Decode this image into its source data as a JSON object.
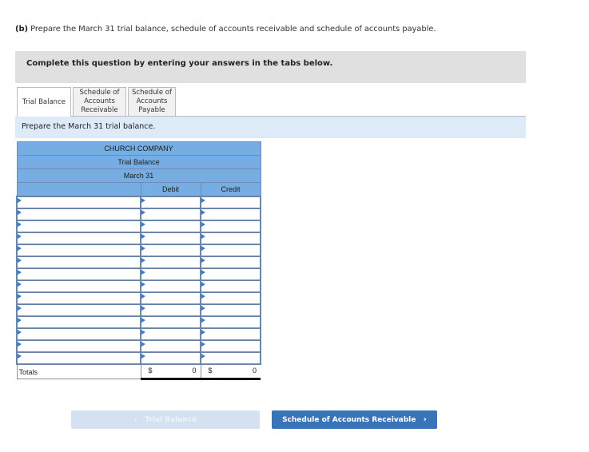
{
  "question": {
    "part_label": "(b)",
    "prompt": "Prepare the March 31 trial balance, schedule of accounts receivable and schedule of accounts payable."
  },
  "instruction_banner": "Complete this question by entering your answers in the tabs below.",
  "tabs": [
    {
      "label": "Trial Balance",
      "active": true
    },
    {
      "label": "Schedule of Accounts Receivable",
      "active": false
    },
    {
      "label": "Schedule of Accounts Payable",
      "active": false
    }
  ],
  "tab_labels": {
    "t1": "Trial Balance",
    "t2_l1": "Schedule of",
    "t2_l2": "Accounts",
    "t2_l3": "Receivable",
    "t3_l1": "Schedule of",
    "t3_l2": "Accounts",
    "t3_l3": "Payable"
  },
  "sub_instruction": "Prepare the March 31 trial balance.",
  "trial_balance": {
    "company": "CHURCH COMPANY",
    "title": "Trial Balance",
    "date": "March 31",
    "columns": {
      "account": "",
      "debit": "Debit",
      "credit": "Credit"
    },
    "rows": [
      {
        "account": "",
        "debit": "",
        "credit": ""
      },
      {
        "account": "",
        "debit": "",
        "credit": ""
      },
      {
        "account": "",
        "debit": "",
        "credit": ""
      },
      {
        "account": "",
        "debit": "",
        "credit": ""
      },
      {
        "account": "",
        "debit": "",
        "credit": ""
      },
      {
        "account": "",
        "debit": "",
        "credit": ""
      },
      {
        "account": "",
        "debit": "",
        "credit": ""
      },
      {
        "account": "",
        "debit": "",
        "credit": ""
      },
      {
        "account": "",
        "debit": "",
        "credit": ""
      },
      {
        "account": "",
        "debit": "",
        "credit": ""
      },
      {
        "account": "",
        "debit": "",
        "credit": ""
      },
      {
        "account": "",
        "debit": "",
        "credit": ""
      },
      {
        "account": "",
        "debit": "",
        "credit": ""
      },
      {
        "account": "",
        "debit": "",
        "credit": ""
      }
    ],
    "totals": {
      "label": "Totals",
      "currency": "$",
      "debit": "0",
      "credit": "0"
    }
  },
  "nav": {
    "prev_label": "Trial Balance",
    "next_label": "Schedule of Accounts Receivable",
    "prev_icon": "chevron-left-icon",
    "next_icon": "chevron-right-icon"
  },
  "colors": {
    "header_blue": "#76ade2",
    "next_button": "#3a74b8",
    "prev_button_disabled": "#d4e1f0",
    "sub_instruction_bg": "#dcebf7"
  }
}
